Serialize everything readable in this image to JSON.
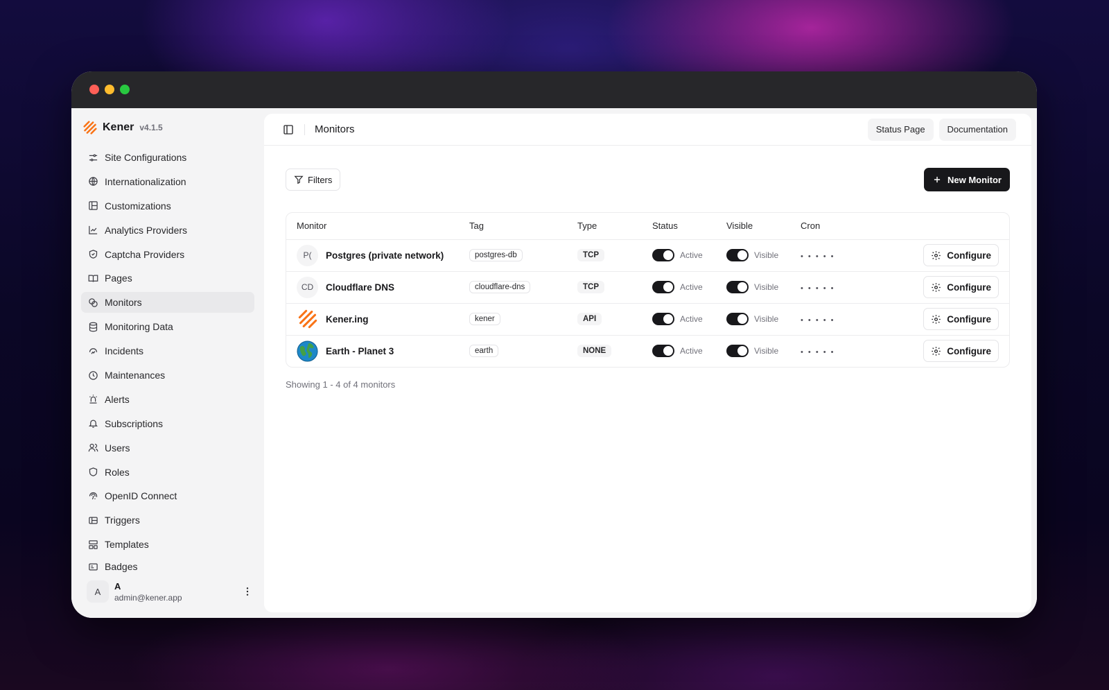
{
  "brand": {
    "name": "Kener",
    "version": "v4.1.5"
  },
  "sidebar": {
    "items": [
      {
        "label": "Site Configurations",
        "icon": "sliders-icon"
      },
      {
        "label": "Internationalization",
        "icon": "globe-icon"
      },
      {
        "label": "Customizations",
        "icon": "layout-icon"
      },
      {
        "label": "Analytics Providers",
        "icon": "chart-line-icon"
      },
      {
        "label": "Captcha Providers",
        "icon": "shield-check-icon"
      },
      {
        "label": "Pages",
        "icon": "book-open-icon"
      },
      {
        "label": "Monitors",
        "icon": "monitors-icon"
      },
      {
        "label": "Monitoring Data",
        "icon": "database-icon"
      },
      {
        "label": "Incidents",
        "icon": "incident-icon"
      },
      {
        "label": "Maintenances",
        "icon": "clock-icon"
      },
      {
        "label": "Alerts",
        "icon": "siren-icon"
      },
      {
        "label": "Subscriptions",
        "icon": "bell-icon"
      },
      {
        "label": "Users",
        "icon": "users-icon"
      },
      {
        "label": "Roles",
        "icon": "shield-icon"
      },
      {
        "label": "OpenID Connect",
        "icon": "fingerprint-icon"
      },
      {
        "label": "Triggers",
        "icon": "webhook-icon"
      },
      {
        "label": "Templates",
        "icon": "template-icon"
      },
      {
        "label": "Badges",
        "icon": "badge-icon"
      }
    ],
    "active": "Monitors"
  },
  "user": {
    "initial": "A",
    "name": "A",
    "email": "admin@kener.app"
  },
  "topbar": {
    "title": "Monitors",
    "status_page": "Status Page",
    "documentation": "Documentation"
  },
  "toolbar": {
    "filters": "Filters",
    "new_monitor": "New Monitor"
  },
  "table": {
    "columns": {
      "monitor": "Monitor",
      "tag": "Tag",
      "type": "Type",
      "status": "Status",
      "visible": "Visible",
      "cron": "Cron"
    },
    "rows": [
      {
        "avatar": "P(",
        "name": "Postgres (private network)",
        "tag": "postgres-db",
        "type": "TCP",
        "status": "Active",
        "visible": "Visible",
        "cron": "• • • • •",
        "action": "Configure"
      },
      {
        "avatar": "CD",
        "name": "Cloudflare DNS",
        "tag": "cloudflare-dns",
        "type": "TCP",
        "status": "Active",
        "visible": "Visible",
        "cron": "• • • • •",
        "action": "Configure"
      },
      {
        "avatar": "",
        "name": "Kener.ing",
        "tag": "kener",
        "type": "API",
        "status": "Active",
        "visible": "Visible",
        "cron": "• • • • •",
        "action": "Configure"
      },
      {
        "avatar": "",
        "name": "Earth - Planet 3",
        "tag": "earth",
        "type": "NONE",
        "status": "Active",
        "visible": "Visible",
        "cron": "• • • • •",
        "action": "Configure"
      }
    ]
  },
  "footer": {
    "summary": "Showing 1 - 4 of 4 monitors"
  },
  "colors": {
    "accent": "#18181b",
    "brand_orange": "#f97316"
  }
}
